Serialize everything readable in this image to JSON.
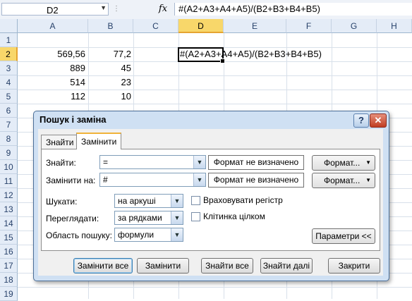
{
  "formula_bar": {
    "name_box": "D2",
    "fx_label": "fx",
    "formula": "#(A2+A3+A4+A5)/(B2+B3+B4+B5)"
  },
  "columns": [
    "A",
    "B",
    "C",
    "D",
    "E",
    "F",
    "G",
    "H"
  ],
  "rows": [
    "1",
    "2",
    "3",
    "4",
    "5",
    "6",
    "7",
    "8",
    "9",
    "10",
    "11",
    "12",
    "13",
    "14",
    "15",
    "16",
    "17",
    "18",
    "19"
  ],
  "selected": {
    "column": "D",
    "row": "2"
  },
  "cells": {
    "A2": "569,56",
    "B2": "77,2",
    "D2": "#(A2+A3+A4+A5)/(B2+B3+B4+B5)",
    "A3": "889",
    "B3": "45",
    "A4": "514",
    "B4": "23",
    "A5": "112",
    "B5": "10"
  },
  "dialog": {
    "title": "Пошук і заміна",
    "help": "?",
    "close": "✕",
    "tabs": [
      "Знайти",
      "Замінити"
    ],
    "active_tab": "Замінити",
    "find_label": "Знайти:",
    "find_value": "=",
    "replace_label": "Замінити на:",
    "replace_value": "#",
    "format_not_set_1": "Формат не визначено",
    "format_not_set_2": "Формат не визначено",
    "format_btn_1": "Формат...",
    "format_btn_2": "Формат...",
    "within_label": "Шукати:",
    "within_value": "на аркуші",
    "search_label": "Переглядати:",
    "search_value": "за рядками",
    "lookin_label": "Область пошуку:",
    "lookin_value": "формули",
    "match_case": "Враховувати регістр",
    "match_cell": "Клітинка цілком",
    "options_btn": "Параметри <<",
    "replace_all": "Замінити все",
    "replace": "Замінити",
    "find_all": "Знайти все",
    "find_next": "Знайти далі",
    "close_btn": "Закрити"
  }
}
